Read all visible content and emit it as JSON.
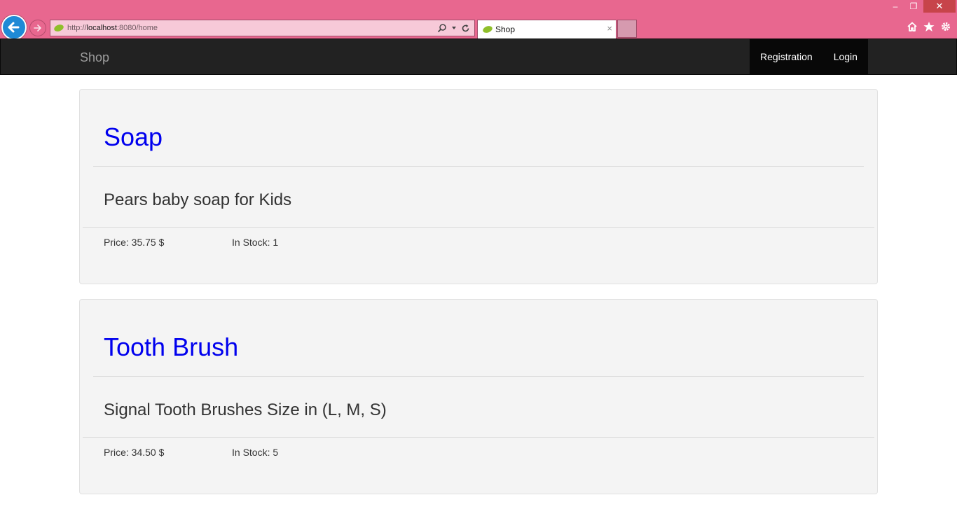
{
  "window": {
    "controls": {
      "minimize": "–",
      "maximize": "❐",
      "close": "✕"
    }
  },
  "browser": {
    "address": {
      "scheme": "http://",
      "host": "localhost",
      "rest": ":8080/home"
    },
    "tab": {
      "title": "Shop",
      "close": "×"
    },
    "icons": [
      "back-arrow-icon",
      "forward-arrow-icon",
      "search-icon",
      "dropdown-icon",
      "refresh-icon",
      "home-icon",
      "favorites-star-icon",
      "settings-gear-icon"
    ],
    "colors": {
      "frame": "#e8678f",
      "back_button": "#1e8ad6"
    }
  },
  "navbar": {
    "brand": "Shop",
    "links": {
      "registration": "Registration",
      "login": "Login"
    },
    "colors": {
      "background": "#222222",
      "active_bg": "#080808"
    }
  },
  "products": [
    {
      "title": "Soap",
      "description": "Pears baby soap for Kids",
      "price": "Price: 35.75 $",
      "stock": "In Stock: 1"
    },
    {
      "title": "Tooth Brush",
      "description": "Signal Tooth Brushes Size in (L, M, S)",
      "price": "Price: 34.50 $",
      "stock": "In Stock: 5"
    }
  ],
  "colors": {
    "title_link": "#0000ee",
    "card_bg": "#f4f4f4"
  }
}
